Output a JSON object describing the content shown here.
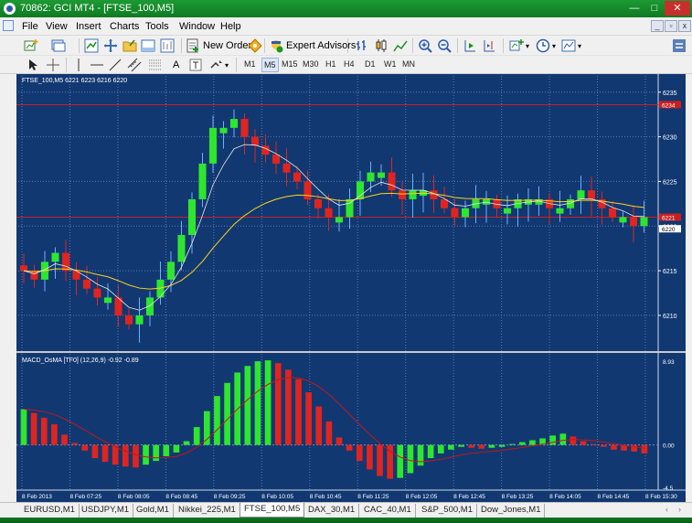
{
  "window": {
    "title": "70862: GCI MT4 - [FTSE_100,M5]",
    "minimize_glyph": "—",
    "maximize_glyph": "□",
    "close_glyph": "✕"
  },
  "menu": {
    "items": [
      "File",
      "View",
      "Insert",
      "Charts",
      "Tools",
      "Window",
      "Help"
    ],
    "mdi_minimize": "_",
    "mdi_restore": "▫",
    "mdi_close": "x"
  },
  "toolbar": {
    "new_order_label": "New Order",
    "expert_advisors_label": "Expert Advisors",
    "text_tool_label": "A",
    "timeframes": [
      "M1",
      "M5",
      "M15",
      "M30",
      "H1",
      "H4",
      "D1",
      "W1",
      "MN"
    ],
    "active_timeframe": "M5"
  },
  "colors": {
    "chart_bg": "#123872",
    "grid": "#5a7bb0",
    "bull": "#2ee62e",
    "bear": "#e0241f",
    "wick_up": "#6ab0ff",
    "ma_slow": "#ffd21a",
    "ma_fast": "#e8e8e8",
    "signal": "#c01818",
    "separator": "#c8c8c8",
    "hline": "#c82020"
  },
  "chart_data": {
    "type": "candlestick",
    "symbol_label": "FTSE_100,M5  6221 6223 6216 6220",
    "price_axis": {
      "ticks": [
        "6235",
        "6230",
        "6225",
        "6220",
        "6215",
        "6210"
      ],
      "ylim": [
        6206,
        6236
      ]
    },
    "hlines": [
      {
        "value": 6233.6,
        "label": "6234"
      },
      {
        "value": 6221,
        "label": "6221"
      }
    ],
    "current_price_label": "6220",
    "time_axis": [
      "8 Feb 2013",
      "8 Feb 07:25",
      "8 Feb 08:05",
      "8 Feb 08:45",
      "8 Feb 09:25",
      "8 Feb 10:05",
      "8 Feb 10:45",
      "8 Feb 11:25",
      "8 Feb 12:05",
      "8 Feb 12:45",
      "8 Feb 13:25",
      "8 Feb 14:05",
      "8 Feb 14:45",
      "8 Feb 15:30"
    ],
    "close_path": [
      6215,
      6214,
      6216,
      6217,
      6215,
      6214,
      6213,
      6212,
      6212,
      6210,
      6209,
      6210,
      6212,
      6214,
      6216,
      6219,
      6223,
      6227,
      6231,
      6231,
      6232,
      6230,
      6229,
      6228,
      6227,
      6226,
      6225,
      6223,
      6222,
      6221,
      6221,
      6223,
      6225,
      6226,
      6226,
      6224,
      6223,
      6224,
      6224,
      6223,
      6222,
      6221,
      6222,
      6223,
      6223,
      6222,
      6222,
      6223,
      6223,
      6223,
      6222,
      6222,
      6223,
      6224,
      6223,
      6222,
      6221,
      6221,
      6220,
      6221
    ],
    "macd_panel": {
      "label": "MACD_OsMA [TF0] (12,26,9)  -0.92 -0.89",
      "ticks": [
        "8.93",
        "0.00",
        "-4.5"
      ],
      "ylim": [
        -4.8,
        9.3
      ],
      "histogram": [
        3.8,
        3.4,
        2.9,
        2.2,
        1.1,
        0.2,
        -0.6,
        -1.4,
        -1.8,
        -2.1,
        -2.3,
        -2.4,
        -2.1,
        -1.7,
        -1.2,
        -0.8,
        0.4,
        1.9,
        3.6,
        5.2,
        6.6,
        7.7,
        8.4,
        8.9,
        9.0,
        8.7,
        8.0,
        7.0,
        5.6,
        4.1,
        2.5,
        0.8,
        -0.6,
        -1.7,
        -2.6,
        -3.3,
        -3.6,
        -3.5,
        -3.0,
        -2.2,
        -1.4,
        -0.9,
        -0.5,
        -0.2,
        -0.3,
        -0.4,
        -0.3,
        -0.2,
        0.1,
        0.3,
        0.5,
        0.7,
        1.0,
        1.2,
        0.9,
        0.4,
        0.1,
        -0.2,
        -0.5,
        -0.6,
        -0.7,
        -0.9
      ]
    }
  },
  "tabs": [
    "EURUSD,M1",
    "USDJPY,M1",
    "Gold,M1",
    "Nikkei_225,M1",
    "FTSE_100,M5",
    "DAX_30,M1",
    "CAC_40,M1",
    "S&P_500,M1",
    "Dow_Jones,M1"
  ],
  "active_tab": "FTSE_100,M5",
  "tab_scroll_left": "‹",
  "tab_scroll_right": "›"
}
